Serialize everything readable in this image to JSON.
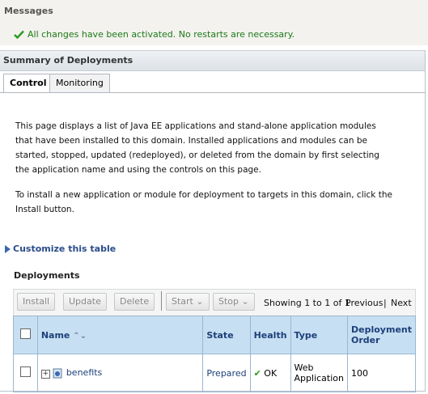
{
  "messages": {
    "title": "Messages",
    "success": "All changes have been activated. No restarts are necessary."
  },
  "summary": {
    "title": "Summary of Deployments",
    "tabs": [
      {
        "label": "Control",
        "active": true
      },
      {
        "label": "Monitoring",
        "active": false
      }
    ],
    "paragraph1": "This page displays a list of Java EE applications and stand-alone application modules that have been installed to this domain. Installed applications and modules can be started, stopped, updated (redeployed), or deleted from the domain by first selecting the application name and using the controls on this page.",
    "paragraph2": "To install a new application or module for deployment to targets in this domain, click the Install button.",
    "customize_label": "Customize this table"
  },
  "deployments": {
    "title": "Deployments",
    "toolbar": {
      "install": "Install",
      "update": "Update",
      "delete": "Delete",
      "start": "Start",
      "stop": "Stop"
    },
    "pager": {
      "showing": "Showing 1 to 1 of 1",
      "previous": "Previous",
      "separator": "|",
      "next": "Next"
    },
    "columns": [
      "Name",
      "State",
      "Health",
      "Type",
      "Deployment Order"
    ],
    "rows": [
      {
        "name": "benefits",
        "state": "Prepared",
        "health": "OK",
        "type": "Web Application",
        "order": "100"
      }
    ]
  },
  "colors": {
    "success_text": "#1d7a18",
    "link": "#1d3f7a",
    "header_bg": "#c7dff2"
  },
  "icons": {
    "success": "checkmark-icon",
    "sort": "sort-arrows-icon",
    "expand": "plus-expand-icon",
    "app": "application-icon",
    "health_ok": "checkmark-icon",
    "customize": "triangle-right-icon"
  }
}
